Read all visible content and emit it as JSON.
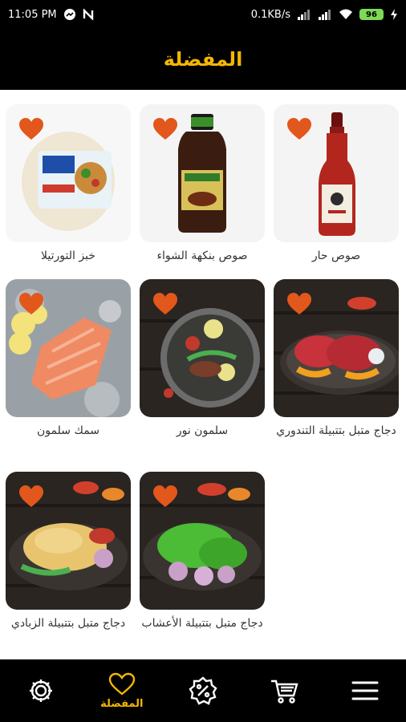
{
  "status_bar": {
    "time": "11:05 PM",
    "speed": "0.1KB/s",
    "battery": "96",
    "icons": [
      "messenger-icon",
      "n-icon",
      "signal-icon",
      "signal-icon",
      "wifi-icon",
      "battery-icon",
      "charging-icon"
    ]
  },
  "header": {
    "title": "المفضلة"
  },
  "products": [
    {
      "name": "صوص حار",
      "image": "hot-sauce-bottle",
      "favorite": true
    },
    {
      "name": "صوص بنكهة الشواء",
      "image": "bbq-sauce-bottle",
      "favorite": true
    },
    {
      "name": "خبز التورتيلا",
      "image": "tortilla-pack",
      "favorite": true
    },
    {
      "name": "دجاج متبل بتتبيلة التندوري",
      "image": "tandoori-chicken",
      "favorite": true
    },
    {
      "name": "سلمون نور",
      "image": "salmon-salad",
      "favorite": true
    },
    {
      "name": "سمك سلمون",
      "image": "salmon-fillet",
      "favorite": true
    },
    {
      "name": "دجاج متبل بتتبيلة الأعشاب",
      "image": "herb-chicken",
      "favorite": true
    },
    {
      "name": "دجاج متبل بتتبيلة الزبادي",
      "image": "yogurt-chicken",
      "favorite": true
    }
  ],
  "bottom_nav": {
    "items": [
      {
        "icon": "settings-icon",
        "label": ""
      },
      {
        "icon": "heart-icon",
        "label": "المفضلة",
        "active": true
      },
      {
        "icon": "discount-icon",
        "label": ""
      },
      {
        "icon": "cart-icon",
        "label": ""
      },
      {
        "icon": "menu-icon",
        "label": ""
      }
    ]
  },
  "colors": {
    "accent": "#f2b705",
    "favorite": "#e2571c",
    "bar": "#000000"
  }
}
